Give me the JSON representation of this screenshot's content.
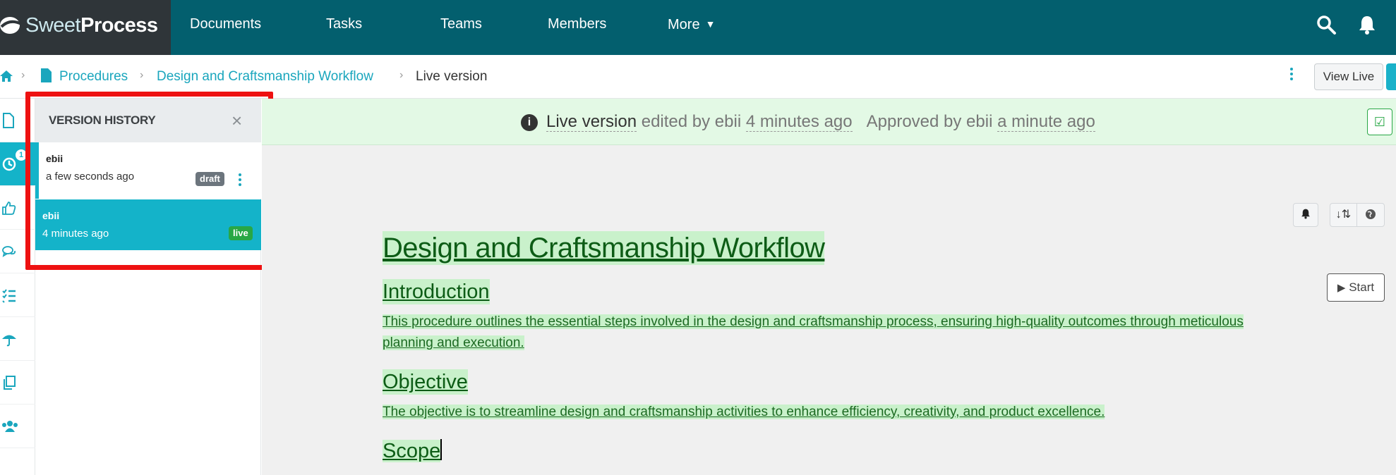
{
  "brand": {
    "name_thin": "Sweet",
    "name_bold": "Process"
  },
  "topnav": {
    "items": [
      "Documents",
      "Tasks",
      "Teams",
      "Members",
      "More"
    ],
    "icons": [
      "search-icon",
      "bell-icon"
    ]
  },
  "breadcrumb": {
    "procedures": "Procedures",
    "workflow": "Design and Craftsmanship Workflow",
    "current": "Live version",
    "separator": "›"
  },
  "toolbar": {
    "view_live": "View Live"
  },
  "rail": {
    "icons": [
      "document-icon",
      "history-icon",
      "thumbs-up-icon",
      "comments-icon",
      "checklist-icon",
      "umbrella-icon",
      "copy-icon",
      "users-icon"
    ],
    "history_badge": "1"
  },
  "version_history": {
    "title": "VERSION HISTORY",
    "close": "×",
    "entries": [
      {
        "user": "ebii",
        "time": "a few seconds ago",
        "tag": "draft"
      },
      {
        "user": "ebii",
        "time": "4 minutes ago",
        "tag": "live"
      }
    ]
  },
  "status": {
    "info": "i",
    "live_version": "Live version",
    "edited_by": "edited by ebii",
    "edited_when": "4 minutes ago",
    "approved_by": "Approved by ebii",
    "approved_when": "a minute ago"
  },
  "controls": {
    "start": "Start"
  },
  "document": {
    "title": "Design and Craftsmanship Workflow",
    "sections": [
      {
        "heading": "Introduction",
        "body_line1": "This procedure outlines the essential steps involved in the design and craftsmanship process, ensuring high-quality outcomes through meticulous",
        "body_line2": "planning and execution."
      },
      {
        "heading": "Objective",
        "body_line1": "The objective is to streamline design and craftsmanship activities to enhance efficiency, creativity, and product excellence."
      },
      {
        "heading": "Scope"
      }
    ]
  },
  "colors": {
    "topnav": "#035f6e",
    "brand_bg": "#2f3539",
    "accent": "#14b3c9",
    "status_bg": "#e3f9e5",
    "doc_text": "#0d5c16",
    "highlight_border": "#ee1111",
    "live_tag": "#28a745",
    "draft_tag": "#6c757d"
  }
}
